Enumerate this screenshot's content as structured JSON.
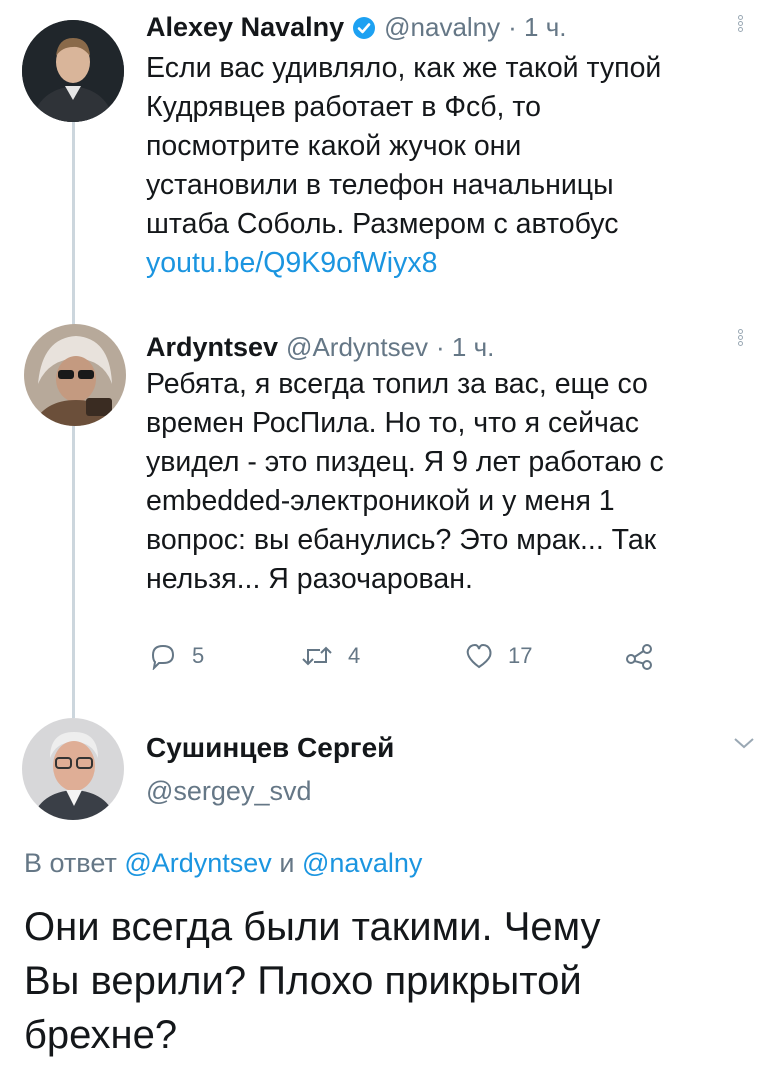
{
  "tweet1": {
    "name": "Alexey Navalny",
    "handle": "@navalny",
    "time": "· 1 ч.",
    "lines": [
      "Если вас удивляло, как же такой тупой",
      "Кудрявцев работает в Фсб, то",
      "посмотрите какой жучок они",
      "установили в телефон начальницы",
      "штаба Соболь. Размером с автобус"
    ],
    "link": "youtu.be/Q9K9ofWiyx8"
  },
  "tweet2": {
    "name": "Ardyntsev",
    "handle": "@Ardyntsev",
    "time": "· 1 ч.",
    "lines": [
      "Ребята, я всегда топил за вас, еще со",
      "времен РосПила. Но то, что я сейчас",
      "увидел - это пиздец. Я 9 лет работаю с",
      "embedded-электроникой и у меня 1",
      "вопрос: вы ебанулись? Это мрак... Так",
      "нельзя... Я разочарован."
    ],
    "actions": {
      "replies": "5",
      "retweets": "4",
      "likes": "17"
    }
  },
  "tweet3": {
    "name": "Сушинцев Сергей",
    "handle": "@sergey_svd",
    "reply_prefix": "В ответ",
    "reply_to_1": "@Ardyntsev",
    "reply_and": "и",
    "reply_to_2": "@navalny",
    "lines": [
      "Они всегда были такими. Чему",
      "Вы верили? Плохо прикрытой",
      "брехне?"
    ]
  },
  "colors": {
    "accent": "#1b95e0",
    "verified": "#1da1f2",
    "muted": "#657786"
  }
}
